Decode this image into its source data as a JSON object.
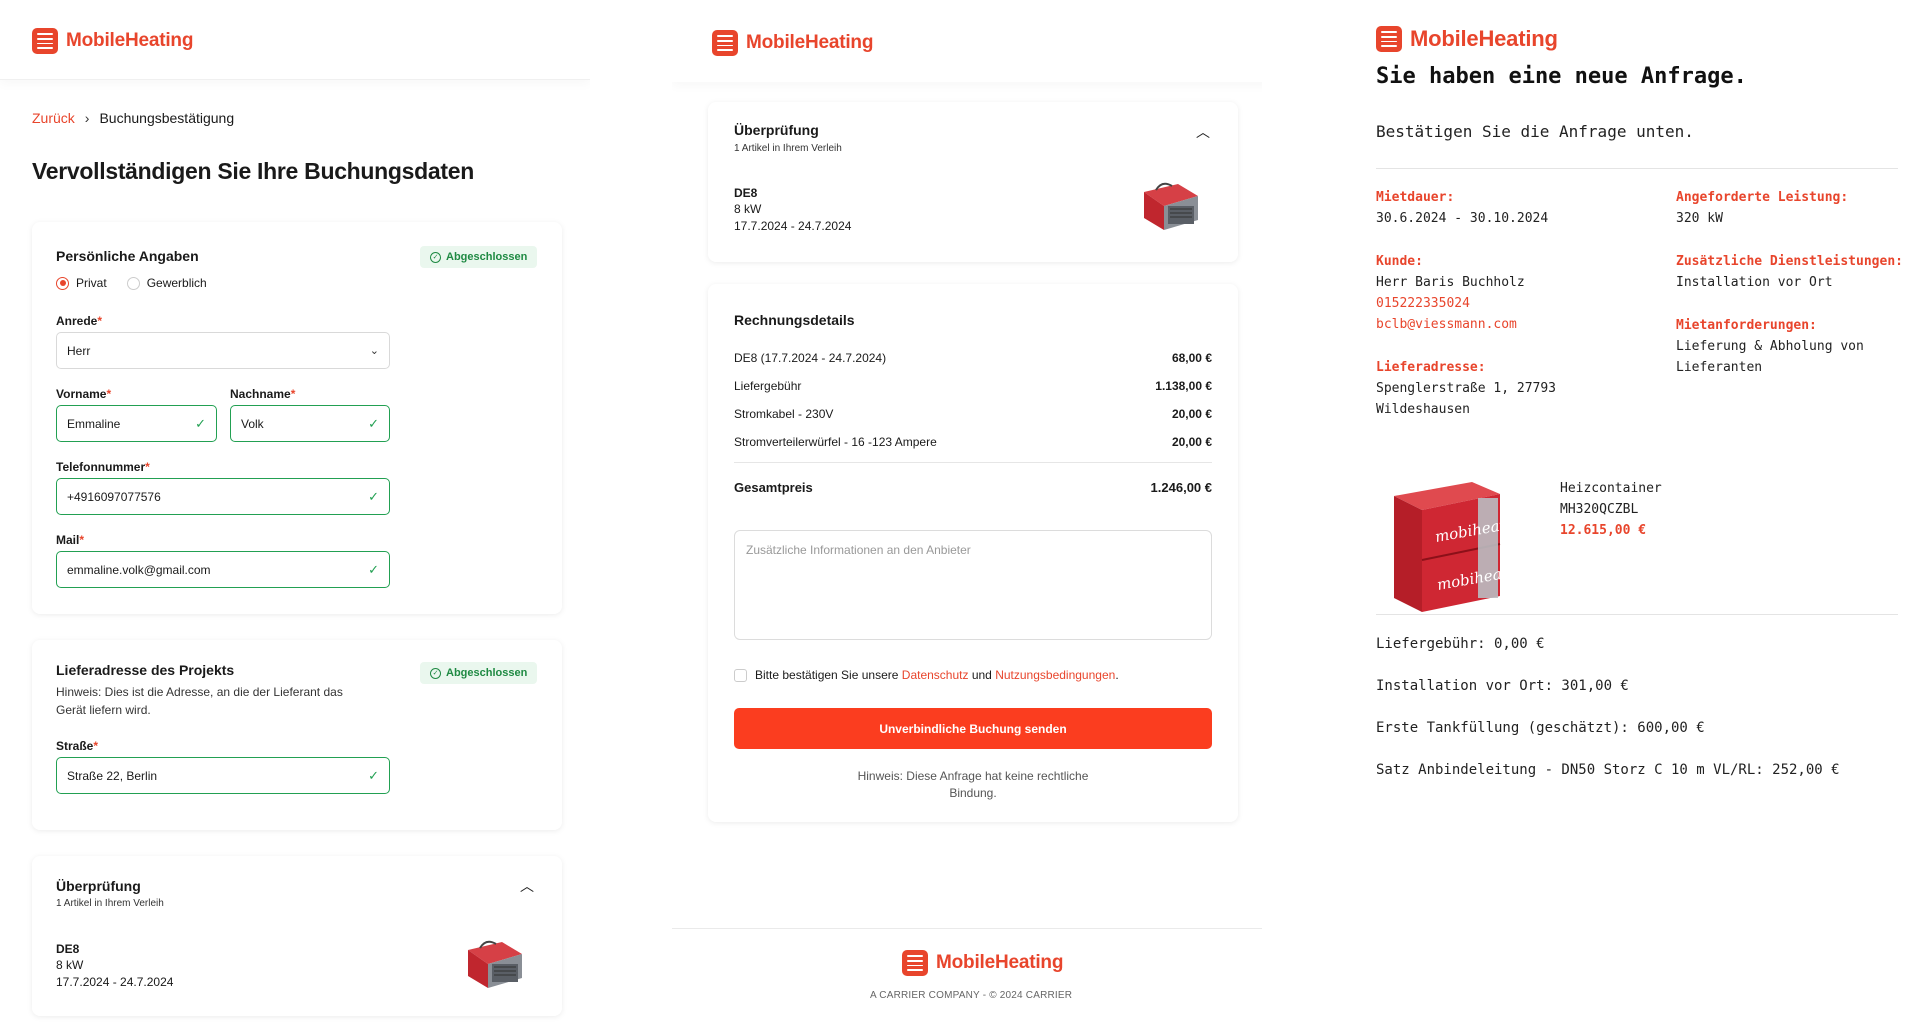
{
  "brand": {
    "name": "MobileHeating"
  },
  "colors": {
    "accent": "#e8452c",
    "success": "#22a052",
    "cta": "#fb3d1f"
  },
  "form": {
    "breadcrumb_back": "Zurück",
    "breadcrumb_current": "Buchungsbestätigung",
    "title": "Vervollständigen Sie Ihre Buchungsdaten",
    "personal": {
      "title": "Persönliche Angaben",
      "badge": "Abgeschlossen",
      "radio_private": "Privat",
      "radio_business": "Gewerblich",
      "salutation_label": "Anrede",
      "salutation_value": "Herr",
      "firstname_label": "Vorname",
      "firstname_value": "Emmaline",
      "lastname_label": "Nachname",
      "lastname_value": "Volk",
      "phone_label": "Telefonnummer",
      "phone_value": "+4916097077576",
      "mail_label": "Mail",
      "mail_value": "emmaline.volk@gmail.com",
      "required_mark": "*"
    },
    "address": {
      "title": "Lieferadresse des Projekts",
      "badge": "Abgeschlossen",
      "hint": "Hinweis: Dies ist die Adresse, an die der Lieferant das Gerät liefern wird.",
      "street_label": "Straße",
      "street_value": "Straße 22, Berlin"
    },
    "review": {
      "title": "Überprüfung",
      "subtitle": "1 Artikel in Ihrem Verleih",
      "item_name": "DE8",
      "item_power": "8 kW",
      "item_dates": "17.7.2024 - 24.7.2024"
    }
  },
  "summary": {
    "review": {
      "title": "Überprüfung",
      "subtitle": "1 Artikel in Ihrem Verleih",
      "item_name": "DE8",
      "item_power": "8 kW",
      "item_dates": "17.7.2024 - 24.7.2024"
    },
    "invoice": {
      "title": "Rechnungsdetails",
      "lines": [
        {
          "label": "DE8 (17.7.2024 - 24.7.2024)",
          "amount": "68,00 €"
        },
        {
          "label": "Liefergebühr",
          "amount": "1.138,00 €"
        },
        {
          "label": "Stromkabel - 230V",
          "amount": "20,00 €"
        },
        {
          "label": "Stromverteilerwürfel - 16 -123 Ampere",
          "amount": "20,00 €"
        }
      ],
      "total_label": "Gesamtpreis",
      "total_amount": "1.246,00 €",
      "notes_placeholder": "Zusätzliche Informationen an den Anbieter",
      "consent_prefix": "Bitte bestätigen Sie unsere",
      "consent_privacy": "Datenschutz",
      "consent_and": "und",
      "consent_terms": "Nutzungsbedingungen",
      "consent_suffix": ".",
      "submit": "Unverbindliche Buchung senden",
      "note_line1": "Hinweis: Diese Anfrage hat keine rechtliche",
      "note_line2": "Bindung."
    },
    "footer_copy": "A CARRIER COMPANY - © 2024 CARRIER"
  },
  "email": {
    "title": "Sie haben eine neue Anfrage.",
    "subtitle": "Bestätigen Sie die Anfrage unten.",
    "rental_label": "Mietdauer:",
    "rental_value": "30.6.2024 - 30.10.2024",
    "power_label": "Angeforderte Leistung:",
    "power_value": "320 kW",
    "customer_label": "Kunde:",
    "customer_name": "Herr Baris Buchholz",
    "customer_phone": "015222335024",
    "customer_email": "bclb@viessmann.com",
    "services_label": "Zusätzliche Dienstleistungen:",
    "services_value": "Installation vor Ort",
    "requirements_label": "Mietanforderungen:",
    "requirements_line1": "Lieferung & Abholung von",
    "requirements_line2": "Lieferanten",
    "address_label": "Lieferadresse:",
    "address_line1": "Spenglerstraße 1, 27793",
    "address_line2": "Wildeshausen",
    "product_type": "Heizcontainer",
    "product_model": "MH320QCZBL",
    "product_price": "12.615,00 €",
    "product_logo_text": "mobiheat",
    "fee_delivery": "Liefergebühr: 0,00 €",
    "fee_install": "Installation vor Ort: 301,00 €",
    "fee_tank": "Erste Tankfüllung (geschätzt): 600,00 €",
    "fee_hose": "Satz Anbindeleitung - DN50 Storz C 10 m VL/RL: 252,00 €"
  }
}
